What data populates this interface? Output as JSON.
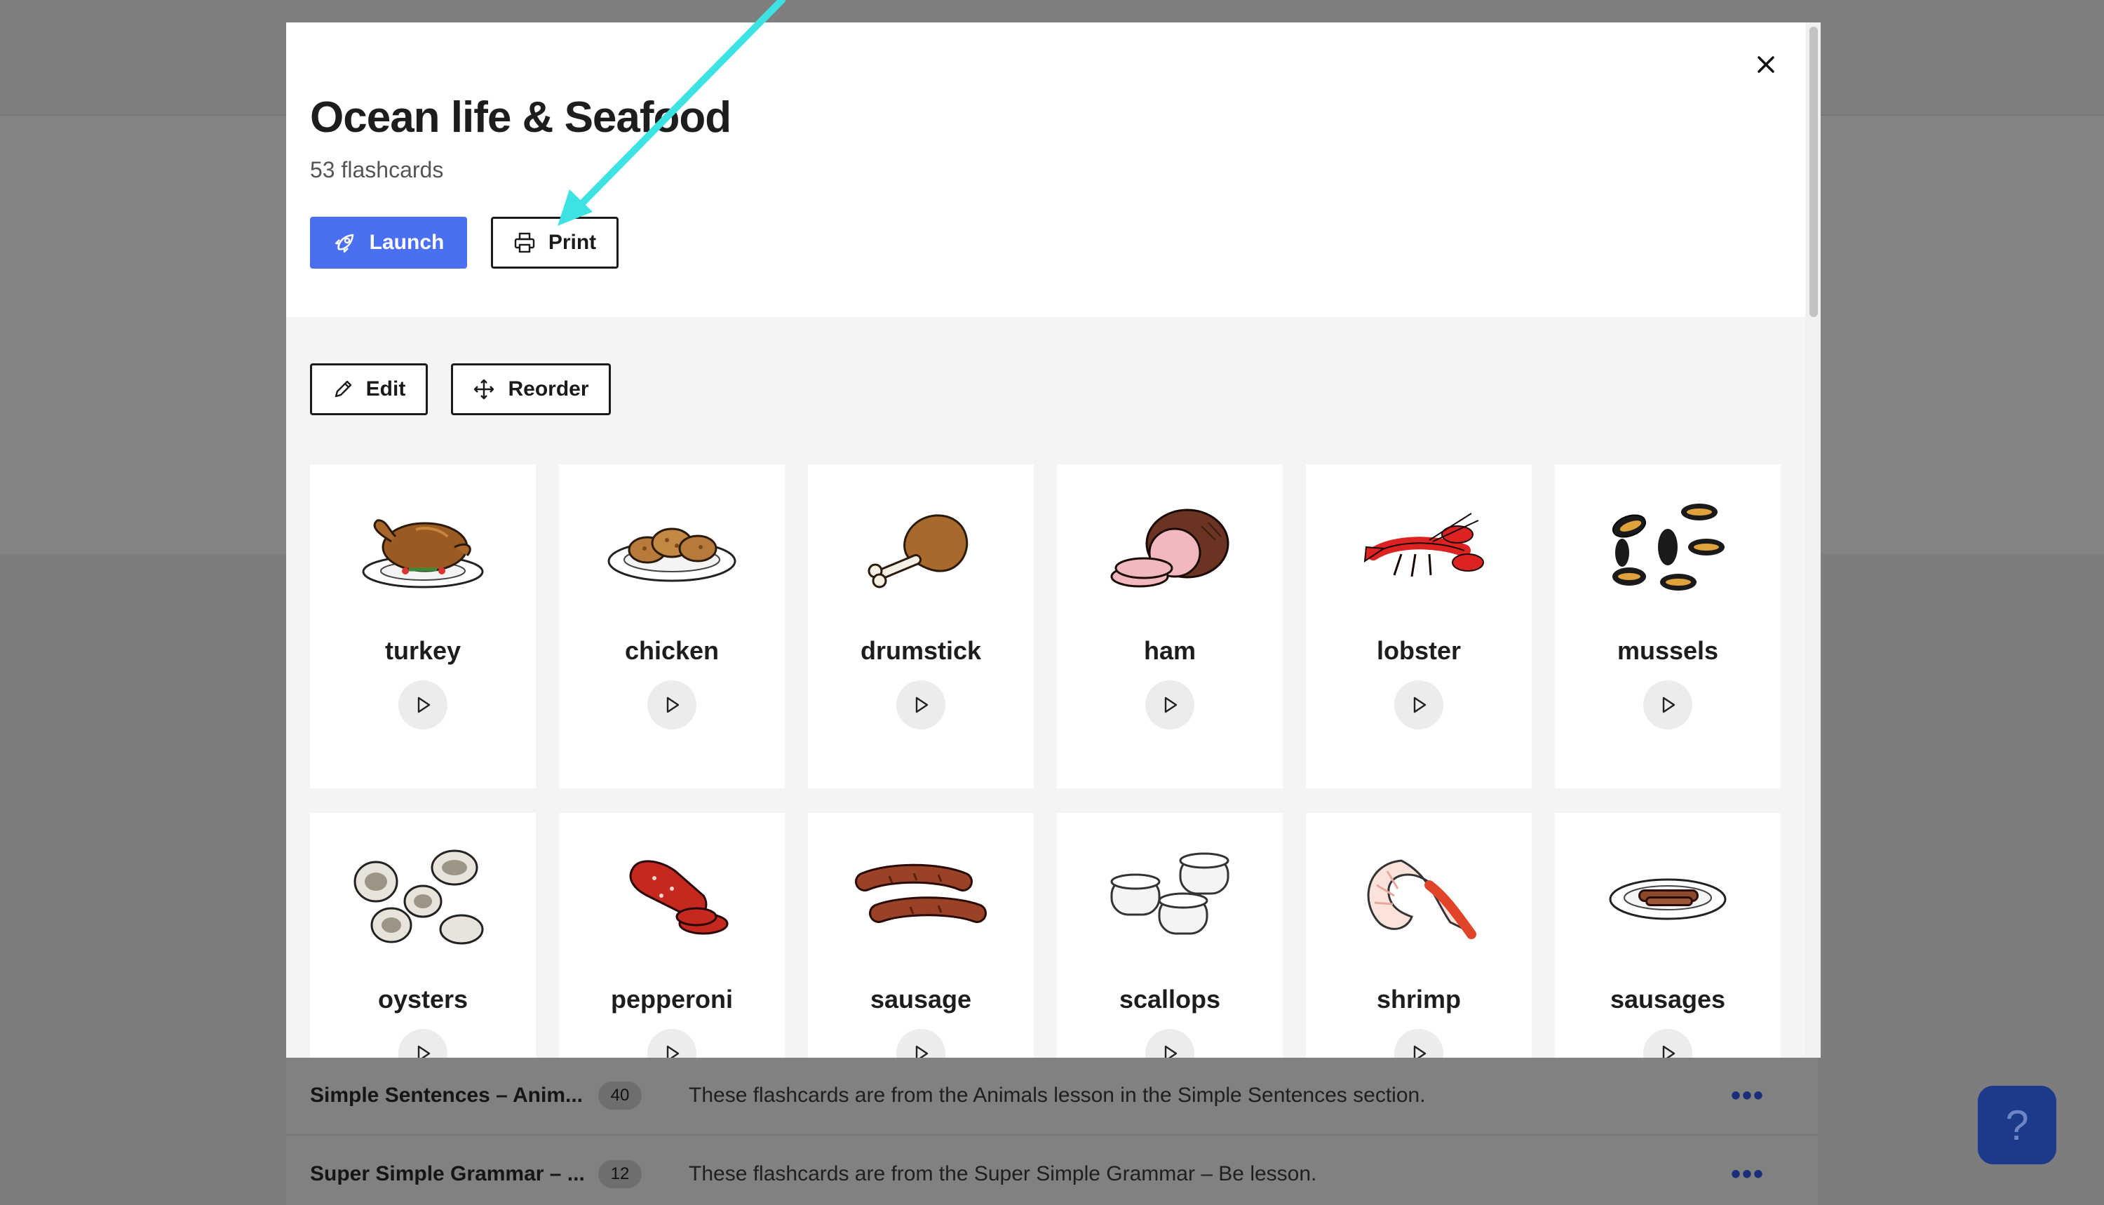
{
  "modal": {
    "title": "Ocean life & Seafood",
    "count_label": "53 flashcards",
    "launch_label": "Launch",
    "print_label": "Print",
    "edit_label": "Edit",
    "reorder_label": "Reorder",
    "cards": [
      {
        "label": "turkey",
        "icon": "turkey-icon"
      },
      {
        "label": "chicken",
        "icon": "chicken-icon"
      },
      {
        "label": "drumstick",
        "icon": "drumstick-icon"
      },
      {
        "label": "ham",
        "icon": "ham-icon"
      },
      {
        "label": "lobster",
        "icon": "lobster-icon"
      },
      {
        "label": "mussels",
        "icon": "mussels-icon"
      },
      {
        "label": "oysters",
        "icon": "oysters-icon"
      },
      {
        "label": "pepperoni",
        "icon": "pepperoni-icon"
      },
      {
        "label": "sausage",
        "icon": "sausage-icon"
      },
      {
        "label": "scallops",
        "icon": "scallops-icon"
      },
      {
        "label": "shrimp",
        "icon": "shrimp-icon"
      },
      {
        "label": "sausages",
        "icon": "sausages-icon"
      }
    ]
  },
  "list": {
    "rows": [
      {
        "title": "Simple Sentences – Anim...",
        "count": "40",
        "description": "These flashcards are from the Animals lesson in the Simple Sentences section."
      },
      {
        "title": "Super Simple Grammar – ...",
        "count": "12",
        "description": "These flashcards are from the Super Simple Grammar – Be lesson."
      }
    ],
    "menu_label": "•••"
  },
  "help_label": "?",
  "colors": {
    "accent": "#4a6ff0",
    "overlay": "#7d7d7d",
    "annotation_arrow": "#3de3e3"
  }
}
